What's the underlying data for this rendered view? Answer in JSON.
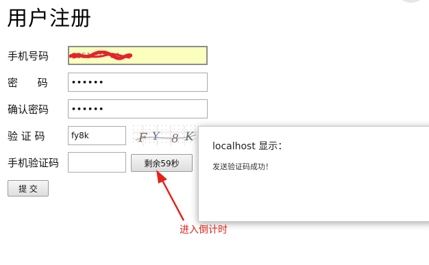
{
  "page": {
    "title": "用户注册"
  },
  "form": {
    "phone": {
      "label": "手机号码",
      "value": "1351*****84"
    },
    "password": {
      "label": "密      码",
      "value": "••••••"
    },
    "confirm": {
      "label": "确认密码",
      "value": "••••••"
    },
    "captcha": {
      "label": "验 证 码",
      "value": "fy8k",
      "image_text": "FY8K"
    },
    "sms": {
      "label": "手机验证码",
      "value": "",
      "button_label": "剩余59秒"
    },
    "submit_label": "提 交"
  },
  "dialog": {
    "title": "localhost 显示：",
    "message": "发送验证码成功！"
  },
  "annotation": {
    "text": "进入倒计时",
    "color": "#e2231a"
  },
  "colors": {
    "autofill": "#faffbd",
    "redact": "#e8212b"
  }
}
